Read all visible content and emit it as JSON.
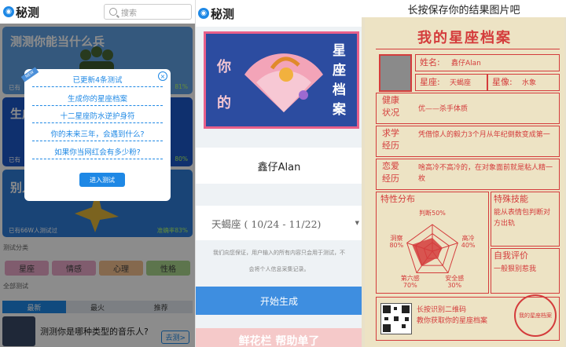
{
  "panel1": {
    "logo_text": "秘测",
    "search_placeholder": "搜索",
    "cards": [
      {
        "title": "测测你能当什么兵",
        "foot_left": "已有",
        "foot_right": "81%"
      },
      {
        "title": "生成",
        "foot_left": "已有",
        "foot_right": "80%"
      },
      {
        "title": "别人",
        "foot_left": "已有66W人测试过",
        "foot_right": "准确率83%"
      }
    ],
    "category_label": "测试分类",
    "categories": [
      "星座",
      "情感",
      "心理",
      "性格"
    ],
    "all_label": "全部测试",
    "tabs": [
      "最新",
      "最火",
      "推荐"
    ],
    "item": {
      "title": "测测你是哪种类型的音乐人?",
      "button": "去测>"
    },
    "modal": {
      "ribbon": "NEW",
      "close": "×",
      "lines": [
        "已更新4条测试",
        "生成你的星座档案",
        "十二星座防水逆护身符",
        "你的未来三年，会遇到什么?",
        "如果你当网红会有多少粉?"
      ],
      "button": "进入测试"
    }
  },
  "panel2": {
    "logo_text": "秘测",
    "banner_left": [
      "你",
      "的"
    ],
    "banner_right": [
      "星",
      "座",
      "档",
      "案"
    ],
    "name": "鑫仔Alan",
    "select_value": "天蝎座 ( 10/24 - 11/22)",
    "note_lines": [
      "我们向您保证，用户输入的所有内容只会用于测试，不",
      "会将个人信息采集记录。"
    ],
    "button": "开始生成",
    "bottom_text": "鲜花栏 帮助单了"
  },
  "panel3": {
    "header": "长按保存你的结果图片吧",
    "title": "我的星座档案",
    "name_label": "姓名:",
    "name_value": "鑫仔Alan",
    "sign_label": "星座:",
    "sign_value": "天蝎座",
    "image_label": "星像:",
    "image_value": "水象",
    "health_label": [
      "健康",
      "状况"
    ],
    "health_value": "优——杀手体质",
    "study_label": [
      "求学",
      "经历"
    ],
    "study_value": "凭借惊人的毅力3个月从年纪倒数变成第一",
    "love_label": [
      "恋爱",
      "经历"
    ],
    "love_value": "啥高冷不高冷的，在对象面前就是粘人精一枚",
    "traits_label": "特性分布",
    "traits": [
      {
        "name": "判断",
        "value": 50
      },
      {
        "name": "高冷",
        "value": 40
      },
      {
        "name": "安全感",
        "value": 30
      },
      {
        "name": "第六感",
        "value": 70
      },
      {
        "name": "洞察",
        "value": 80
      }
    ],
    "skill_label": "特殊技能",
    "skill_value": "能从表情包判断对方出轨",
    "self_label": "自我评价",
    "self_value": "一般狠别惹我",
    "qr_text": [
      "长按识别二维码",
      "教你获取你的星座档案"
    ],
    "seal_text": "我的星座档案"
  }
}
